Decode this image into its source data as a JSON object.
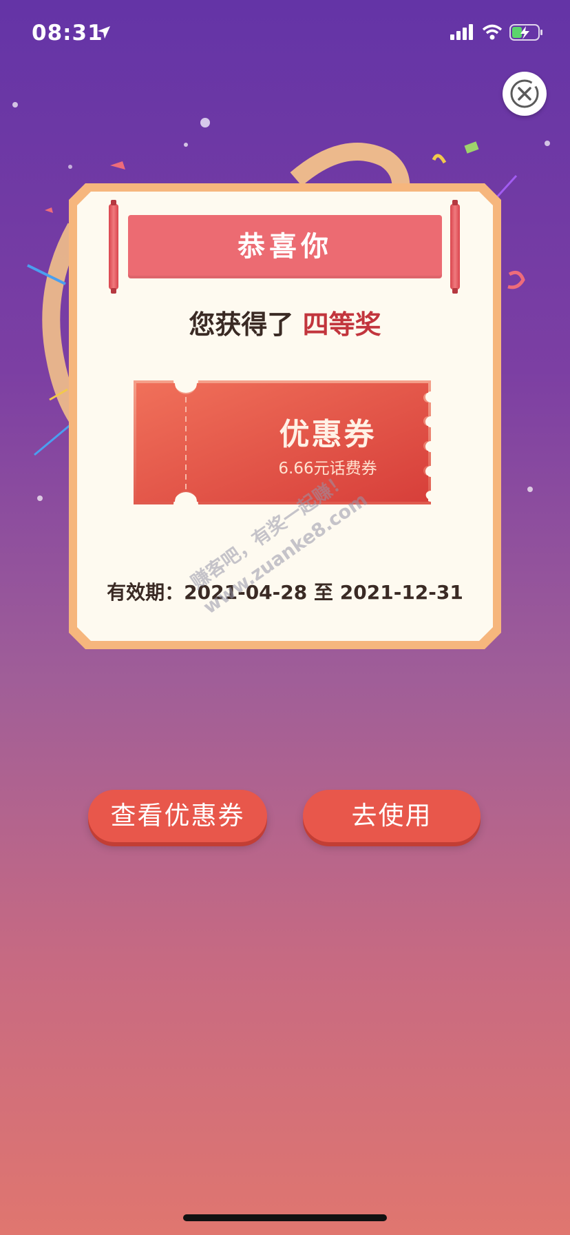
{
  "status_bar": {
    "time": "08:31"
  },
  "dialog": {
    "banner_title": "恭喜你",
    "prize_prefix": "您获得了",
    "prize_name": "四等奖",
    "coupon_title": "优惠券",
    "coupon_detail": "6.66元话费券",
    "validity_label": "有效期：",
    "validity_start": "2021-04-28",
    "validity_sep": "至",
    "validity_end": "2021-12-31"
  },
  "buttons": {
    "view_coupon": "查看优惠券",
    "go_use": "去使用"
  },
  "watermark": {
    "line1": "赚客吧，有奖一起赚！",
    "line2": "www.zuanke8.com"
  },
  "colors": {
    "accent_red": "#E8574B",
    "banner": "#EC6B72",
    "prize_text": "#C2353D",
    "card_frame": "#F6B67D",
    "card_bg": "#FEFAF0"
  },
  "icons": [
    "location-arrow-icon",
    "signal-icon",
    "wifi-icon",
    "battery-charging-icon",
    "close-icon"
  ]
}
